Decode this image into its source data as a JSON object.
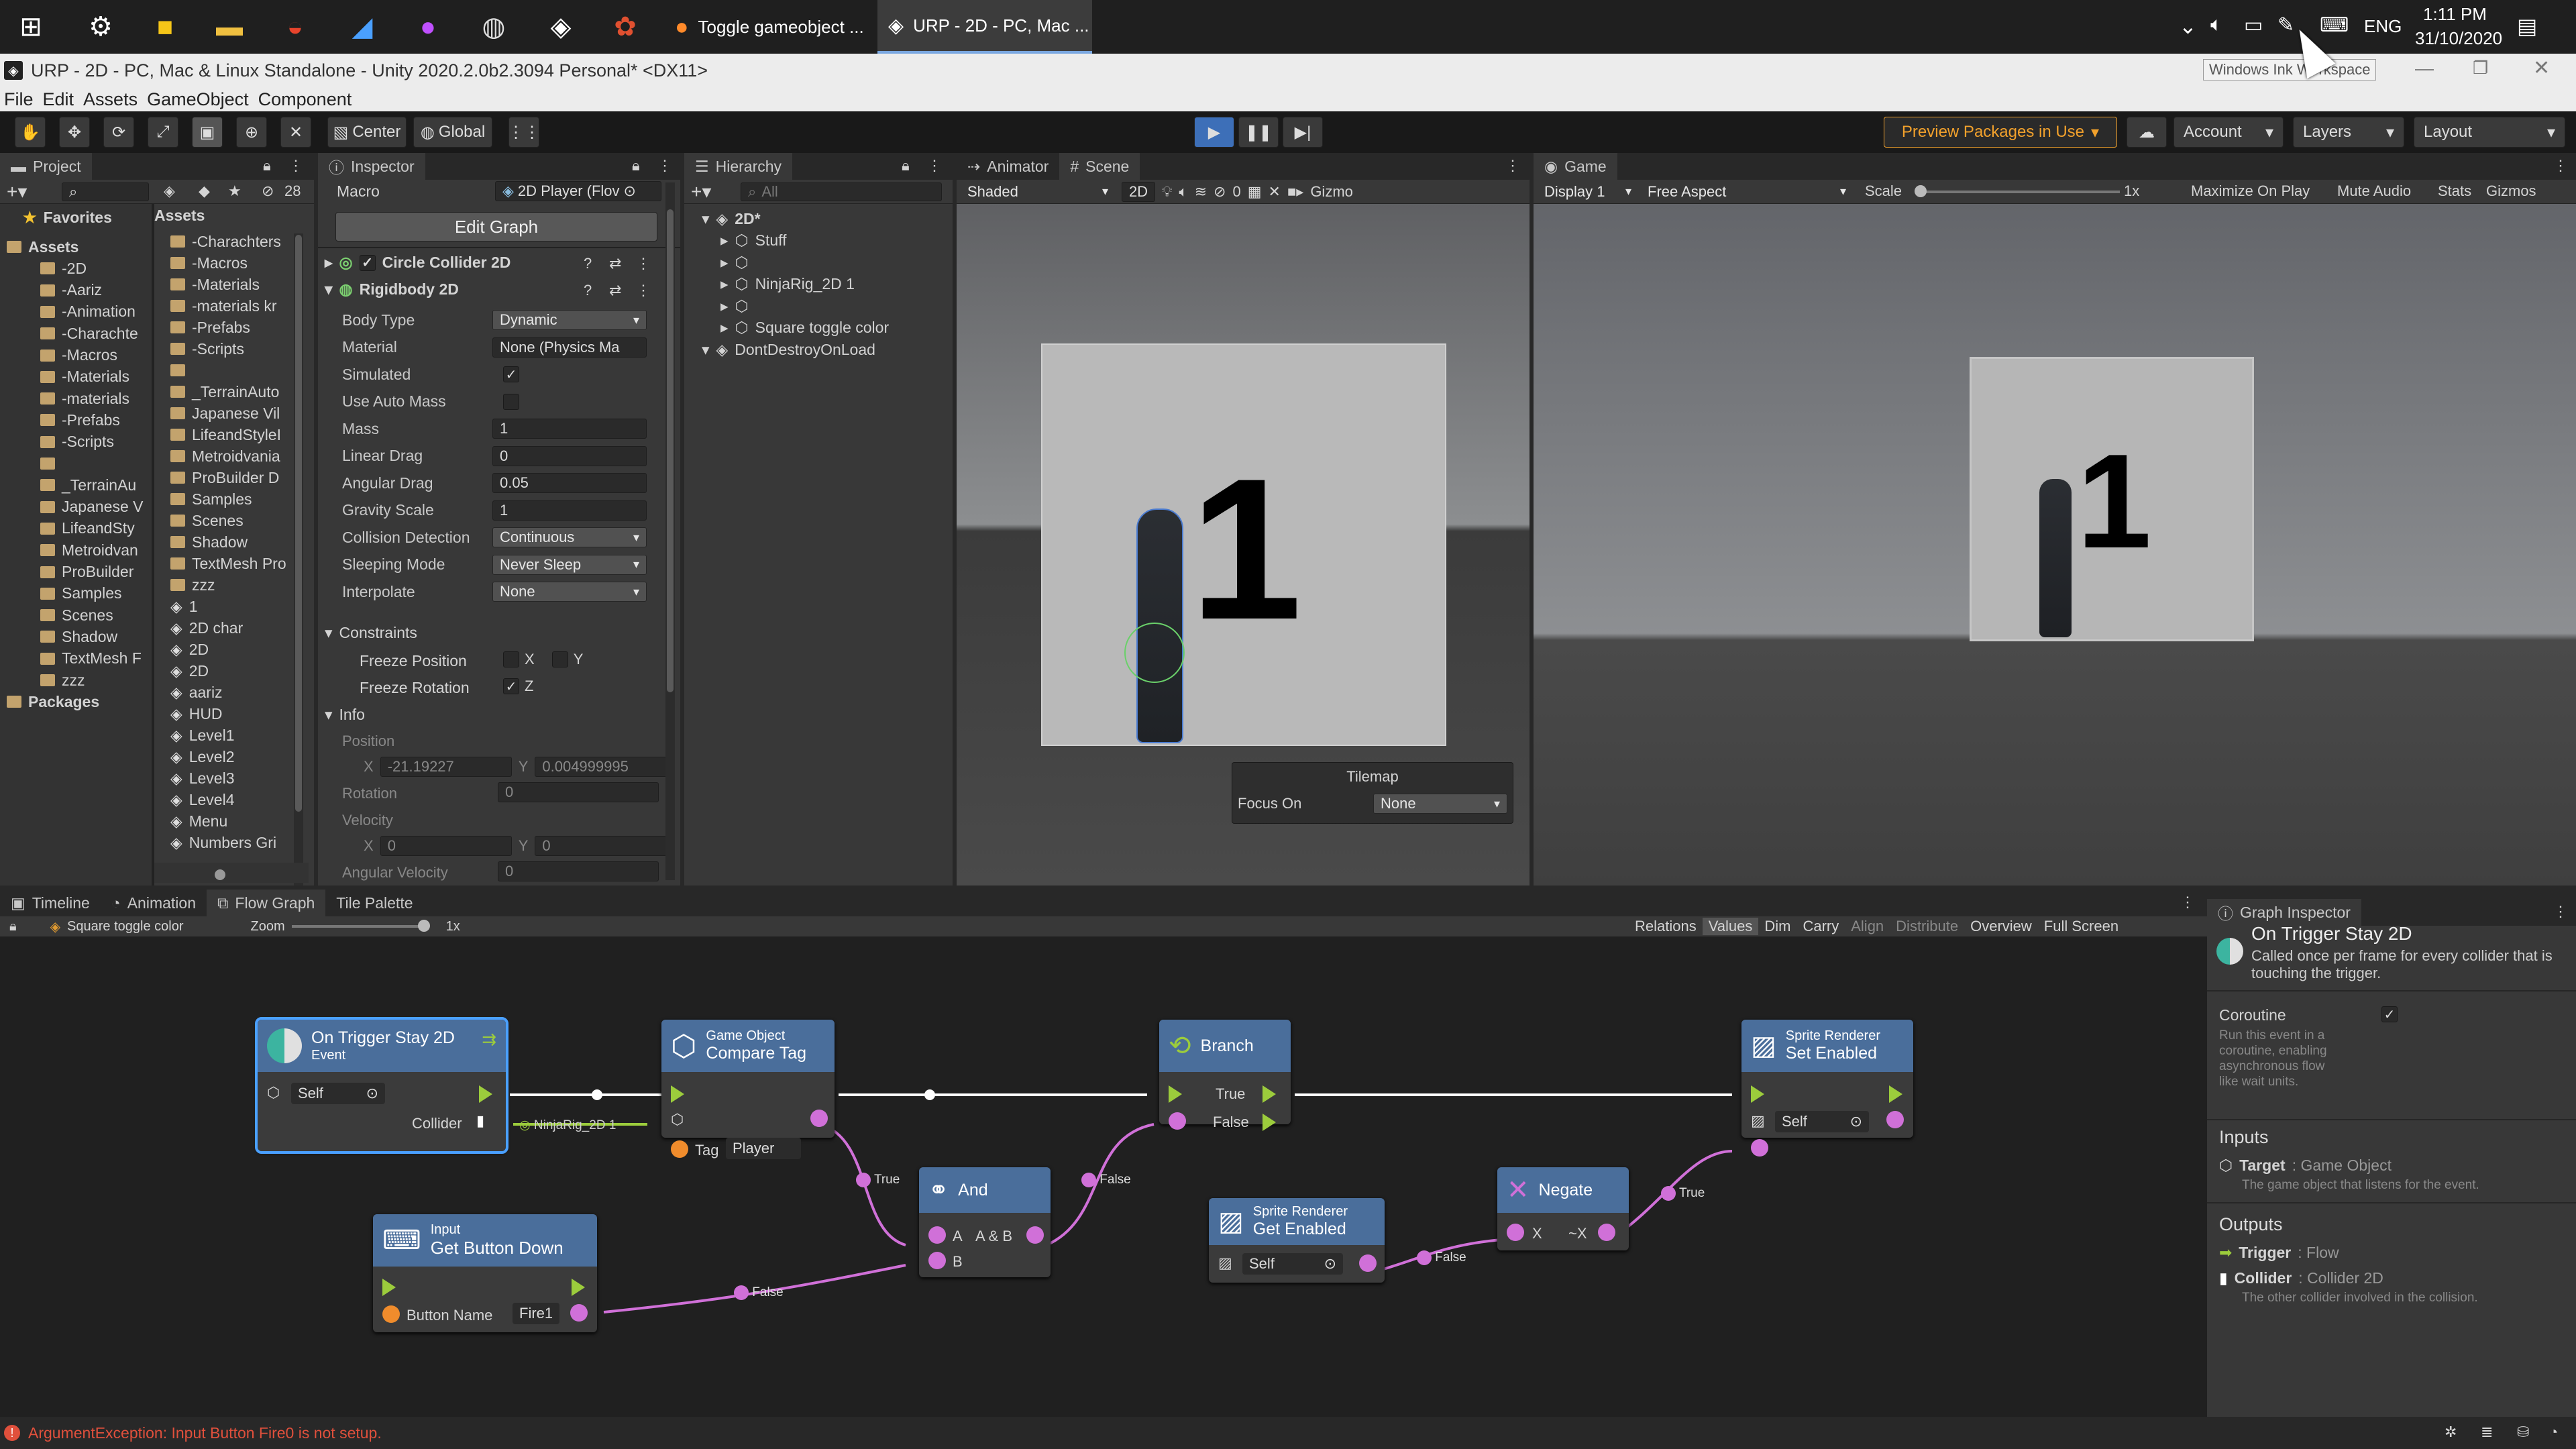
{
  "taskbar": {
    "tasks": [
      "Toggle gameobject ...",
      "URP - 2D - PC, Mac ..."
    ],
    "tray_lang": "ENG",
    "time": "1:11 PM",
    "date": "31/10/2020",
    "tooltip": "Windows Ink Workspace"
  },
  "window": {
    "title": "URP - 2D - PC, Mac & Linux Standalone - Unity 2020.2.0b2.3094 Personal* <DX11>",
    "menu": [
      "File",
      "Edit",
      "Assets",
      "GameObject",
      "Component"
    ]
  },
  "toolbar": {
    "center": "Center",
    "global": "Global",
    "preview_packages": "Preview Packages in Use",
    "account": "Account",
    "layers": "Layers",
    "layout": "Layout"
  },
  "project": {
    "tab": "Project",
    "search_count": "28",
    "favorites": "Favorites",
    "assets_header": "Assets",
    "tree": [
      "Assets",
      "-2D",
      "-Aariz",
      "-Animation",
      "-Charachte",
      "-Macros",
      "-Materials",
      "-materials",
      "-Prefabs",
      "-Scripts",
      "",
      "_TerrainAu",
      "Japanese V",
      "LifeandSty",
      "Metroidvan",
      "ProBuilder",
      "Samples",
      "Scenes",
      "Shadow",
      "TextMesh F",
      "zzz",
      "Packages"
    ],
    "list": [
      "-Charachters",
      "-Macros",
      "-Materials",
      "-materials kr",
      "-Prefabs",
      "-Scripts",
      "",
      "_TerrainAuto",
      "Japanese Vil",
      "LifeandStyleI",
      "Metroidvania",
      "ProBuilder D",
      "Samples",
      "Scenes",
      "Shadow",
      "TextMesh Pro",
      "zzz",
      "1",
      "2D char",
      "2D",
      "2D",
      "aariz",
      "HUD",
      "Level1",
      "Level2",
      "Level3",
      "Level4",
      "Menu",
      "Numbers Gri"
    ]
  },
  "inspector": {
    "tab": "Inspector",
    "macro_label": "Macro",
    "macro_value": "2D Player (Flov",
    "edit_graph": "Edit Graph",
    "circle_collider": "Circle Collider 2D",
    "rigidbody": "Rigidbody 2D",
    "fields": [
      {
        "label": "Body Type",
        "value": "Dynamic",
        "kind": "dd"
      },
      {
        "label": "Material",
        "value": "None (Physics Ma",
        "kind": "obj"
      },
      {
        "label": "Simulated",
        "value": "✓",
        "kind": "cb"
      },
      {
        "label": "Use Auto Mass",
        "value": "",
        "kind": "cb"
      },
      {
        "label": "Mass",
        "value": "1",
        "kind": "field"
      },
      {
        "label": "Linear Drag",
        "value": "0",
        "kind": "field"
      },
      {
        "label": "Angular Drag",
        "value": "0.05",
        "kind": "field"
      },
      {
        "label": "Gravity Scale",
        "value": "1",
        "kind": "field"
      },
      {
        "label": "Collision Detection",
        "value": "Continuous",
        "kind": "dd"
      },
      {
        "label": "Sleeping Mode",
        "value": "Never Sleep",
        "kind": "dd"
      },
      {
        "label": "Interpolate",
        "value": "None",
        "kind": "dd"
      }
    ],
    "constraints": "Constraints",
    "freeze_position": "Freeze Position",
    "freeze_rotation": "Freeze Rotation",
    "x": "X",
    "y": "Y",
    "z": "Z",
    "info": "Info",
    "position": "Position",
    "pos_x": "-21.19227",
    "pos_y": "0.004999995",
    "rotation": "Rotation",
    "rotation_value": "0",
    "velocity": "Velocity",
    "vel_x": "0",
    "vel_y": "0",
    "angular_velocity": "Angular Velocity",
    "angular_velocity_value": "0"
  },
  "hierarchy": {
    "tab": "Hierarchy",
    "search_placeholder": "All",
    "items": [
      "2D*",
      "Stuff",
      "",
      "NinjaRig_2D 1",
      "",
      "Square toggle color",
      "DontDestroyOnLoad"
    ]
  },
  "scene": {
    "tabs": [
      "Animator",
      "Scene"
    ],
    "shading": "Shaded",
    "mode_2d": "2D",
    "hidden_count": "0",
    "gizmos": "Gizmo",
    "number": "1",
    "tilemap_title": "Tilemap",
    "focus_on": "Focus On",
    "focus_value": "None"
  },
  "game": {
    "tab": "Game",
    "display": "Display 1",
    "aspect": "Free Aspect",
    "scale": "Scale",
    "scale_value": "1x",
    "buttons": [
      "Maximize On Play",
      "Mute Audio",
      "Stats",
      "Gizmos"
    ],
    "number": "1"
  },
  "bottom": {
    "tabs": [
      "Timeline",
      "Animation",
      "Flow Graph",
      "Tile Palette"
    ],
    "breadcrumb": "Square toggle color",
    "zoom": "Zoom",
    "zoom_value": "1x",
    "graph_tools": [
      "Relations",
      "Values",
      "Dim",
      "Carry",
      "Align",
      "Distribute",
      "Overview",
      "Full Screen"
    ]
  },
  "graph": {
    "trigger": {
      "title": "On Trigger Stay 2D",
      "subtitle": "Event",
      "self": "Self",
      "collider": "Collider"
    },
    "ninja_label": "NinjaRig_2D 1",
    "compare": {
      "category": "Game Object",
      "title": "Compare Tag",
      "tag": "Tag",
      "tag_value": "Player"
    },
    "branch": {
      "title": "Branch",
      "true": "True",
      "false": "False"
    },
    "setenabled": {
      "category": "Sprite Renderer",
      "title": "Set Enabled",
      "self": "Self"
    },
    "and": {
      "title": "And",
      "a": "A",
      "ab": "A & B",
      "b": "B"
    },
    "getenabled": {
      "category": "Sprite Renderer",
      "title": "Get Enabled",
      "self": "Self"
    },
    "negate": {
      "title": "Negate",
      "x": "X",
      "nx": "~X"
    },
    "input": {
      "category": "Input",
      "title": "Get Button Down",
      "button_name": "Button Name",
      "button_value": "Fire1"
    },
    "labels": {
      "true1": "True",
      "false1": "False",
      "false2": "False",
      "true2": "True",
      "false3": "False"
    }
  },
  "graph_inspector": {
    "tab": "Graph Inspector",
    "title": "On Trigger Stay 2D",
    "desc": "Called once per frame for every collider that is touching the trigger.",
    "coroutine": "Coroutine",
    "coroutine_check": "✓",
    "coroutine_desc": "Run this event in a coroutine, enabling asynchronous flow like wait units.",
    "inputs": "Inputs",
    "target": "Target",
    "target_type": ": Game Object",
    "target_desc": "The game object that listens for the event.",
    "outputs": "Outputs",
    "trigger": "Trigger",
    "trigger_type": ": Flow",
    "collider": "Collider",
    "collider_type": ": Collider 2D",
    "collider_desc": "The other collider involved in the collision."
  },
  "status": {
    "error": "ArgumentException: Input Button Fire0 is not setup."
  },
  "colors": {
    "node_head": "#4a6e9b",
    "port": "#d070d8",
    "flow": "#9ccc3c",
    "error": "#e0503c"
  }
}
